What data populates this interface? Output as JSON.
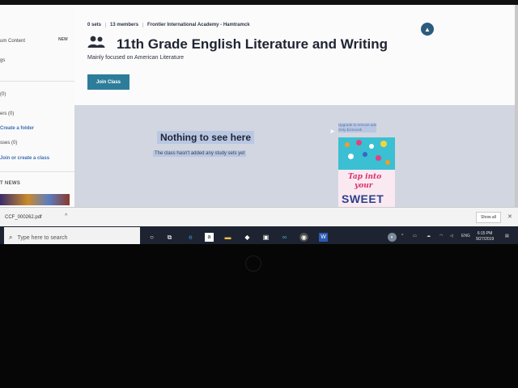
{
  "sidebar": {
    "items": [
      {
        "label": "um Content"
      },
      {
        "label": "NEW"
      },
      {
        "label": "gs"
      },
      {
        "label": "(0)"
      },
      {
        "label": "ers (0)"
      },
      {
        "label": "Create a folder"
      },
      {
        "label": "sses (0)"
      },
      {
        "label": "Join or create a class"
      },
      {
        "label": "T NEWS"
      }
    ]
  },
  "class": {
    "sets": "0 sets",
    "members": "13 members",
    "school": "Frontier International Academy - Hamtramck",
    "title": "11th Grade English Literature and Writing",
    "description": "Mainly focused on American Literature",
    "join_label": "Join Class"
  },
  "empty_state": {
    "title": "Nothing to see here",
    "subtitle": "The class hasn't added any study sets yet"
  },
  "ad": {
    "label_line1": "Upgrade to remove ads",
    "label_line2": "Only $1/month",
    "line1": "Tap into",
    "line2": "your",
    "line3": "SWEET"
  },
  "download_bar": {
    "file_name": "CCF_000262.pdf",
    "show_all_label": "Show all"
  },
  "taskbar": {
    "search_placeholder": "Type here to search",
    "tray_lang": "ENG",
    "time": "6:15 PM",
    "date": "9/27/2019"
  },
  "colors": {
    "join_button": "#2d7d9a",
    "content_bg": "#d2d6e0",
    "taskbar": "#1d2330"
  },
  "icons": {
    "members": "people-icon",
    "alert": "alert-icon"
  }
}
